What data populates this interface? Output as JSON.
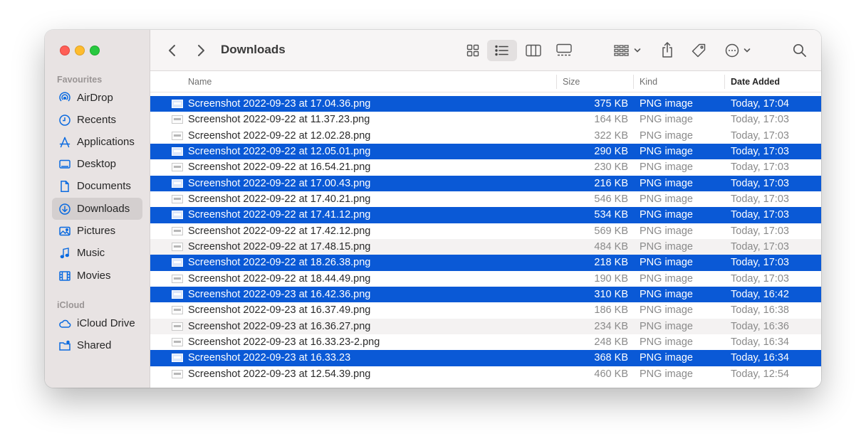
{
  "window": {
    "title": "Downloads"
  },
  "sidebar": {
    "favourites_label": "Favourites",
    "favourites": [
      {
        "label": "AirDrop",
        "icon": "airdrop-icon"
      },
      {
        "label": "Recents",
        "icon": "clock-icon"
      },
      {
        "label": "Applications",
        "icon": "applications-icon"
      },
      {
        "label": "Desktop",
        "icon": "desktop-icon"
      },
      {
        "label": "Documents",
        "icon": "document-icon"
      },
      {
        "label": "Downloads",
        "icon": "download-icon",
        "active": true
      },
      {
        "label": "Pictures",
        "icon": "pictures-icon"
      },
      {
        "label": "Music",
        "icon": "music-note-icon"
      },
      {
        "label": "Movies",
        "icon": "film-icon"
      }
    ],
    "icloud_label": "iCloud",
    "icloud": [
      {
        "label": "iCloud Drive",
        "icon": "cloud-icon"
      },
      {
        "label": "Shared",
        "icon": "shared-folder-icon"
      }
    ]
  },
  "toolbar": {
    "icons": [
      "chevron-left-icon",
      "chevron-right-icon",
      "icon-view-icon",
      "list-view-icon",
      "column-view-icon",
      "gallery-view-icon",
      "group-icon",
      "share-icon",
      "tag-icon",
      "more-icon",
      "search-icon"
    ],
    "active_view": "list",
    "accent": "#0a59d6"
  },
  "columns": {
    "name": "Name",
    "size": "Size",
    "kind": "Kind",
    "date_added": "Date Added"
  },
  "files": [
    {
      "name": "Screenshot 2022-09-23 at 17.04.36.png",
      "size": "375 KB",
      "kind": "PNG image",
      "date": "Today, 17:04",
      "selected": true
    },
    {
      "name": "Screenshot 2022-09-22 at 11.37.23.png",
      "size": "164 KB",
      "kind": "PNG image",
      "date": "Today, 17:03",
      "selected": false
    },
    {
      "name": "Screenshot 2022-09-22 at 12.02.28.png",
      "size": "322 KB",
      "kind": "PNG image",
      "date": "Today, 17:03",
      "selected": false
    },
    {
      "name": "Screenshot 2022-09-22 at 12.05.01.png",
      "size": "290 KB",
      "kind": "PNG image",
      "date": "Today, 17:03",
      "selected": true
    },
    {
      "name": "Screenshot 2022-09-22 at 16.54.21.png",
      "size": "230 KB",
      "kind": "PNG image",
      "date": "Today, 17:03",
      "selected": false
    },
    {
      "name": "Screenshot 2022-09-22 at 17.00.43.png",
      "size": "216 KB",
      "kind": "PNG image",
      "date": "Today, 17:03",
      "selected": true
    },
    {
      "name": "Screenshot 2022-09-22 at 17.40.21.png",
      "size": "546 KB",
      "kind": "PNG image",
      "date": "Today, 17:03",
      "selected": false
    },
    {
      "name": "Screenshot 2022-09-22 at 17.41.12.png",
      "size": "534 KB",
      "kind": "PNG image",
      "date": "Today, 17:03",
      "selected": true
    },
    {
      "name": "Screenshot 2022-09-22 at 17.42.12.png",
      "size": "569 KB",
      "kind": "PNG image",
      "date": "Today, 17:03",
      "selected": false
    },
    {
      "name": "Screenshot 2022-09-22 at 17.48.15.png",
      "size": "484 KB",
      "kind": "PNG image",
      "date": "Today, 17:03",
      "selected": false
    },
    {
      "name": "Screenshot 2022-09-22 at 18.26.38.png",
      "size": "218 KB",
      "kind": "PNG image",
      "date": "Today, 17:03",
      "selected": true
    },
    {
      "name": "Screenshot 2022-09-22 at 18.44.49.png",
      "size": "190 KB",
      "kind": "PNG image",
      "date": "Today, 17:03",
      "selected": false
    },
    {
      "name": "Screenshot 2022-09-23 at 16.42.36.png",
      "size": "310 KB",
      "kind": "PNG image",
      "date": "Today, 16:42",
      "selected": true
    },
    {
      "name": "Screenshot 2022-09-23 at 16.37.49.png",
      "size": "186 KB",
      "kind": "PNG image",
      "date": "Today, 16:38",
      "selected": false
    },
    {
      "name": "Screenshot 2022-09-23 at 16.36.27.png",
      "size": "234 KB",
      "kind": "PNG image",
      "date": "Today, 16:36",
      "selected": false
    },
    {
      "name": "Screenshot 2022-09-23 at 16.33.23-2.png",
      "size": "248 KB",
      "kind": "PNG image",
      "date": "Today, 16:34",
      "selected": false
    },
    {
      "name": "Screenshot 2022-09-23 at 16.33.23",
      "size": "368 KB",
      "kind": "PNG image",
      "date": "Today, 16:34",
      "selected": true
    },
    {
      "name": "Screenshot 2022-09-23 at 12.54.39.png",
      "size": "460 KB",
      "kind": "PNG image",
      "date": "Today, 12:54",
      "selected": false
    }
  ]
}
